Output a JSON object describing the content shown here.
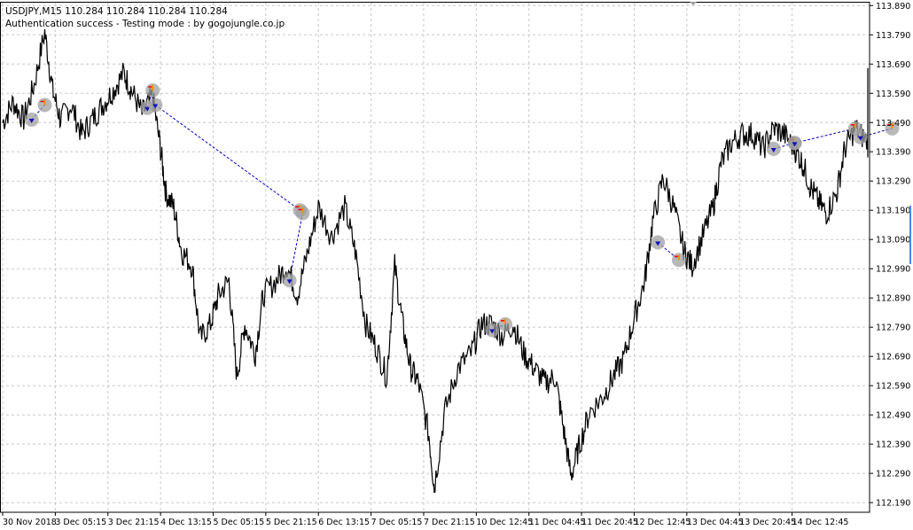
{
  "header": {
    "symbol_line": "USDJPY,M15  110.284 110.284 110.284 110.284",
    "status_line": "Authentication success - Testing mode : by gogojungle.co.jp"
  },
  "colors": {
    "background": "#ffffff",
    "price_line": "#000000",
    "grid": "#c8c8c8",
    "trade_line": "#0000cc",
    "trade_marker": "#1010c0",
    "trade_halo": "#a0a0a0",
    "trade_accent": "#ff8c00",
    "stop_mark": "#ff0000",
    "scroll_marker": "#4a86e8"
  },
  "chart_data": {
    "type": "line",
    "symbol": "USDJPY",
    "timeframe": "M15",
    "grid": true,
    "ylim": [
      112.16,
      113.9
    ],
    "yticks": [
      "113.890",
      "113.790",
      "113.690",
      "113.590",
      "113.490",
      "113.390",
      "113.290",
      "113.190",
      "113.090",
      "112.990",
      "112.890",
      "112.790",
      "112.690",
      "112.590",
      "112.490",
      "112.390",
      "112.290",
      "112.190"
    ],
    "xticks": [
      "30 Nov 2018",
      "3 Dec 05:15",
      "3 Dec 21:15",
      "4 Dec 13:15",
      "5 Dec 05:15",
      "5 Dec 21:15",
      "6 Dec 13:15",
      "7 Dec 05:15",
      "7 Dec 21:15",
      "10 Dec 12:45",
      "11 Dec 04:45",
      "11 Dec 20:45",
      "12 Dec 12:45",
      "13 Dec 04:45",
      "13 Dec 20:45",
      "14 Dec 12:45"
    ],
    "price_path": [
      [
        0,
        113.49
      ],
      [
        0.2,
        113.56
      ],
      [
        0.4,
        113.5
      ],
      [
        0.6,
        113.62
      ],
      [
        0.8,
        113.8
      ],
      [
        0.95,
        113.6
      ],
      [
        1.1,
        113.5
      ],
      [
        1.3,
        113.55
      ],
      [
        1.5,
        113.45
      ],
      [
        1.7,
        113.5
      ],
      [
        1.9,
        113.55
      ],
      [
        2.1,
        113.6
      ],
      [
        2.3,
        113.66
      ],
      [
        2.45,
        113.6
      ],
      [
        2.65,
        113.52
      ],
      [
        2.85,
        113.58
      ],
      [
        3.0,
        113.4
      ],
      [
        3.1,
        113.25
      ],
      [
        3.25,
        113.2
      ],
      [
        3.4,
        113.05
      ],
      [
        3.6,
        113.0
      ],
      [
        3.75,
        112.75
      ],
      [
        3.95,
        112.8
      ],
      [
        4.1,
        112.9
      ],
      [
        4.3,
        112.95
      ],
      [
        4.45,
        112.62
      ],
      [
        4.6,
        112.8
      ],
      [
        4.8,
        112.7
      ],
      [
        4.95,
        112.9
      ],
      [
        5.2,
        112.95
      ],
      [
        5.4,
        113.0
      ],
      [
        5.6,
        112.9
      ],
      [
        5.8,
        113.05
      ],
      [
        6.0,
        113.2
      ],
      [
        6.25,
        113.1
      ],
      [
        6.5,
        113.2
      ],
      [
        6.7,
        113.05
      ],
      [
        6.9,
        112.8
      ],
      [
        7.1,
        112.72
      ],
      [
        7.3,
        112.62
      ],
      [
        7.45,
        113.0
      ],
      [
        7.6,
        112.8
      ],
      [
        7.75,
        112.65
      ],
      [
        7.9,
        112.6
      ],
      [
        8.1,
        112.42
      ],
      [
        8.2,
        112.24
      ],
      [
        8.4,
        112.5
      ],
      [
        8.65,
        112.65
      ],
      [
        8.9,
        112.7
      ],
      [
        9.1,
        112.8
      ],
      [
        9.3,
        112.8
      ],
      [
        9.5,
        112.76
      ],
      [
        9.7,
        112.8
      ],
      [
        9.9,
        112.7
      ],
      [
        10.1,
        112.65
      ],
      [
        10.3,
        112.6
      ],
      [
        10.5,
        112.62
      ],
      [
        10.65,
        112.45
      ],
      [
        10.8,
        112.28
      ],
      [
        10.95,
        112.38
      ],
      [
        11.15,
        112.5
      ],
      [
        11.4,
        112.55
      ],
      [
        11.6,
        112.62
      ],
      [
        11.8,
        112.68
      ],
      [
        12.0,
        112.82
      ],
      [
        12.2,
        112.95
      ],
      [
        12.35,
        113.15
      ],
      [
        12.55,
        113.3
      ],
      [
        12.75,
        113.2
      ],
      [
        12.95,
        113.05
      ],
      [
        13.1,
        113.0
      ],
      [
        13.3,
        113.1
      ],
      [
        13.5,
        113.2
      ],
      [
        13.65,
        113.35
      ],
      [
        13.85,
        113.42
      ],
      [
        14.05,
        113.45
      ],
      [
        14.25,
        113.45
      ],
      [
        14.45,
        113.4
      ],
      [
        14.65,
        113.47
      ],
      [
        14.85,
        113.45
      ],
      [
        15.05,
        113.4
      ],
      [
        15.2,
        113.35
      ],
      [
        15.35,
        113.27
      ],
      [
        15.5,
        113.22
      ],
      [
        15.65,
        113.18
      ],
      [
        15.85,
        113.25
      ],
      [
        16.0,
        113.4
      ],
      [
        16.2,
        113.47
      ],
      [
        16.4,
        113.43
      ],
      [
        16.6,
        113.4
      ],
      [
        16.8,
        113.42
      ],
      [
        17.0,
        113.5
      ],
      [
        17.2,
        113.6
      ],
      [
        17.4,
        113.65
      ],
      [
        17.6,
        113.58
      ],
      [
        17.8,
        113.56
      ],
      [
        18.0,
        113.52
      ],
      [
        18.2,
        113.45
      ],
      [
        18.4,
        113.48
      ],
      [
        18.6,
        113.42
      ],
      [
        18.8,
        113.5
      ],
      [
        19.0,
        113.55
      ],
      [
        19.2,
        113.6
      ],
      [
        19.35,
        113.55
      ],
      [
        19.5,
        113.5
      ]
    ],
    "trades": [
      {
        "entry": [
          0.55,
          113.5
        ],
        "exit": [
          0.8,
          113.55
        ]
      },
      {
        "entry": [
          2.75,
          113.54
        ],
        "exit": [
          2.85,
          113.6
        ]
      },
      {
        "entry": [
          2.9,
          113.55
        ],
        "exit": [
          5.65,
          113.19
        ]
      },
      {
        "entry": [
          5.45,
          112.95
        ],
        "exit": [
          5.7,
          113.18
        ]
      },
      {
        "entry": [
          9.3,
          112.78
        ],
        "exit": [
          9.55,
          112.8
        ]
      },
      {
        "entry": [
          12.45,
          113.08
        ],
        "exit": [
          12.85,
          113.02
        ]
      },
      {
        "entry": [
          14.65,
          113.4
        ],
        "exit": [
          15.05,
          113.42
        ]
      },
      {
        "entry": [
          15.05,
          113.42
        ],
        "exit": [
          16.2,
          113.47
        ]
      },
      {
        "entry": [
          16.3,
          113.44
        ],
        "exit": [
          16.9,
          113.47
        ]
      },
      {
        "entry": [
          17.6,
          113.57
        ],
        "exit": [
          17.75,
          113.6
        ]
      }
    ]
  }
}
